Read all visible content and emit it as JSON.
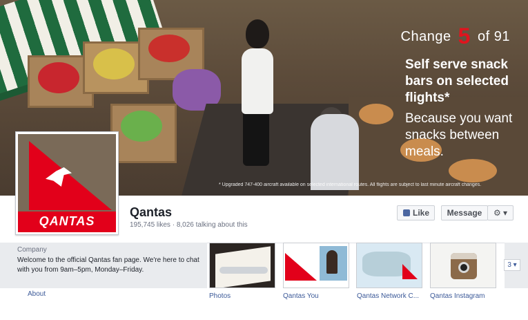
{
  "cover": {
    "ad": {
      "change_prefix": "Change",
      "change_number": "5",
      "change_suffix": "of 91",
      "headline": "Self serve snack bars on selected flights*",
      "subline": "Because you want snacks between meals.",
      "footnote": "* Upgraded 747-400 aircraft available on selected international routes. All flights are subject to last minute aircraft changes."
    }
  },
  "profile": {
    "logo_text": "QANTAS",
    "name": "Qantas",
    "stats": "195,745 likes · 8,026 talking about this"
  },
  "actions": {
    "like_label": "Like",
    "message_label": "Message",
    "gear_label": "⚙ ▾"
  },
  "about": {
    "category": "Company",
    "description": "Welcome to the official Qantas fan page. We're here to chat with you from 9am–5pm, Monday–Friday.",
    "link": "About"
  },
  "tabs": [
    {
      "label": "Photos"
    },
    {
      "label": "Qantas You"
    },
    {
      "label": "Qantas Network C..."
    },
    {
      "label": "Qantas Instagram"
    }
  ],
  "more_button": "3 ▾",
  "colors": {
    "brand_red": "#e2001a",
    "link_blue": "#3b5998"
  }
}
